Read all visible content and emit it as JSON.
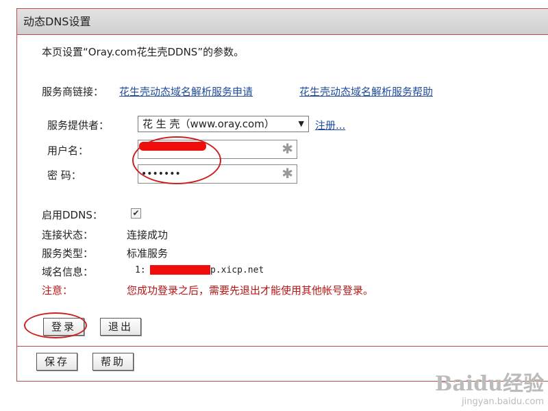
{
  "panel": {
    "title": "动态DNS设置"
  },
  "intro": "本页设置“Oray.com花生壳DDNS”的参数。",
  "provider_links": {
    "label": "服务商链接：",
    "apply": "花生壳动态域名解析服务申请",
    "help": "花生壳动态域名解析服务帮助"
  },
  "form": {
    "provider_label": "服务提供者：",
    "provider_value": "花 生 壳（www.oray.com）",
    "register_link": "注册...",
    "username_label": "用户名：",
    "password_label": "密  码：",
    "password_value": "•••••••",
    "required_mark": "✱"
  },
  "status": {
    "ddns_label": "启用DDNS：",
    "ddns_enabled": true,
    "conn_label": "连接状态：",
    "conn_value": "连接成功",
    "service_label": "服务类型：",
    "service_value": "标准服务",
    "domain_label": "域名信息：",
    "domain_prefix": "1:",
    "domain_suffix": "p.xicp.net",
    "note_label": "注意：",
    "note_text": "您成功登录之后，需要先退出才能使用其他帐号登录。"
  },
  "buttons": {
    "login": "登录",
    "logout": "退出",
    "save": "保存",
    "help": "帮助"
  },
  "watermark": {
    "brand": "Baidu经验",
    "url": "jingyan.baidu.com"
  },
  "colors": {
    "border": "#b64a44",
    "link": "#1e4c9c",
    "warning": "#b81515",
    "redaction": "#f20d0d"
  }
}
